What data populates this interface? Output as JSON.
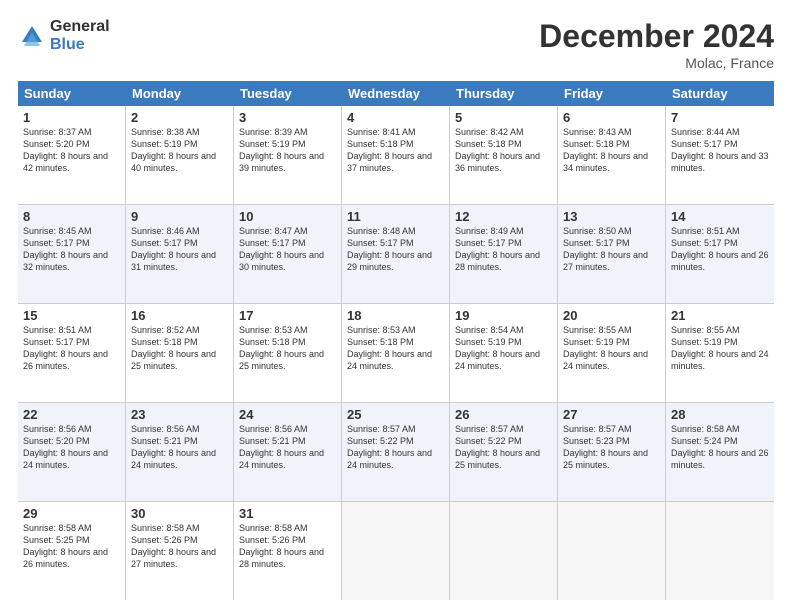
{
  "header": {
    "logo_general": "General",
    "logo_blue": "Blue",
    "month_title": "December 2024",
    "location": "Molac, France"
  },
  "weekdays": [
    "Sunday",
    "Monday",
    "Tuesday",
    "Wednesday",
    "Thursday",
    "Friday",
    "Saturday"
  ],
  "weeks": [
    [
      {
        "day": "1",
        "sunrise": "Sunrise: 8:37 AM",
        "sunset": "Sunset: 5:20 PM",
        "daylight": "Daylight: 8 hours and 42 minutes."
      },
      {
        "day": "2",
        "sunrise": "Sunrise: 8:38 AM",
        "sunset": "Sunset: 5:19 PM",
        "daylight": "Daylight: 8 hours and 40 minutes."
      },
      {
        "day": "3",
        "sunrise": "Sunrise: 8:39 AM",
        "sunset": "Sunset: 5:19 PM",
        "daylight": "Daylight: 8 hours and 39 minutes."
      },
      {
        "day": "4",
        "sunrise": "Sunrise: 8:41 AM",
        "sunset": "Sunset: 5:18 PM",
        "daylight": "Daylight: 8 hours and 37 minutes."
      },
      {
        "day": "5",
        "sunrise": "Sunrise: 8:42 AM",
        "sunset": "Sunset: 5:18 PM",
        "daylight": "Daylight: 8 hours and 36 minutes."
      },
      {
        "day": "6",
        "sunrise": "Sunrise: 8:43 AM",
        "sunset": "Sunset: 5:18 PM",
        "daylight": "Daylight: 8 hours and 34 minutes."
      },
      {
        "day": "7",
        "sunrise": "Sunrise: 8:44 AM",
        "sunset": "Sunset: 5:17 PM",
        "daylight": "Daylight: 8 hours and 33 minutes."
      }
    ],
    [
      {
        "day": "8",
        "sunrise": "Sunrise: 8:45 AM",
        "sunset": "Sunset: 5:17 PM",
        "daylight": "Daylight: 8 hours and 32 minutes."
      },
      {
        "day": "9",
        "sunrise": "Sunrise: 8:46 AM",
        "sunset": "Sunset: 5:17 PM",
        "daylight": "Daylight: 8 hours and 31 minutes."
      },
      {
        "day": "10",
        "sunrise": "Sunrise: 8:47 AM",
        "sunset": "Sunset: 5:17 PM",
        "daylight": "Daylight: 8 hours and 30 minutes."
      },
      {
        "day": "11",
        "sunrise": "Sunrise: 8:48 AM",
        "sunset": "Sunset: 5:17 PM",
        "daylight": "Daylight: 8 hours and 29 minutes."
      },
      {
        "day": "12",
        "sunrise": "Sunrise: 8:49 AM",
        "sunset": "Sunset: 5:17 PM",
        "daylight": "Daylight: 8 hours and 28 minutes."
      },
      {
        "day": "13",
        "sunrise": "Sunrise: 8:50 AM",
        "sunset": "Sunset: 5:17 PM",
        "daylight": "Daylight: 8 hours and 27 minutes."
      },
      {
        "day": "14",
        "sunrise": "Sunrise: 8:51 AM",
        "sunset": "Sunset: 5:17 PM",
        "daylight": "Daylight: 8 hours and 26 minutes."
      }
    ],
    [
      {
        "day": "15",
        "sunrise": "Sunrise: 8:51 AM",
        "sunset": "Sunset: 5:17 PM",
        "daylight": "Daylight: 8 hours and 26 minutes."
      },
      {
        "day": "16",
        "sunrise": "Sunrise: 8:52 AM",
        "sunset": "Sunset: 5:18 PM",
        "daylight": "Daylight: 8 hours and 25 minutes."
      },
      {
        "day": "17",
        "sunrise": "Sunrise: 8:53 AM",
        "sunset": "Sunset: 5:18 PM",
        "daylight": "Daylight: 8 hours and 25 minutes."
      },
      {
        "day": "18",
        "sunrise": "Sunrise: 8:53 AM",
        "sunset": "Sunset: 5:18 PM",
        "daylight": "Daylight: 8 hours and 24 minutes."
      },
      {
        "day": "19",
        "sunrise": "Sunrise: 8:54 AM",
        "sunset": "Sunset: 5:19 PM",
        "daylight": "Daylight: 8 hours and 24 minutes."
      },
      {
        "day": "20",
        "sunrise": "Sunrise: 8:55 AM",
        "sunset": "Sunset: 5:19 PM",
        "daylight": "Daylight: 8 hours and 24 minutes."
      },
      {
        "day": "21",
        "sunrise": "Sunrise: 8:55 AM",
        "sunset": "Sunset: 5:19 PM",
        "daylight": "Daylight: 8 hours and 24 minutes."
      }
    ],
    [
      {
        "day": "22",
        "sunrise": "Sunrise: 8:56 AM",
        "sunset": "Sunset: 5:20 PM",
        "daylight": "Daylight: 8 hours and 24 minutes."
      },
      {
        "day": "23",
        "sunrise": "Sunrise: 8:56 AM",
        "sunset": "Sunset: 5:21 PM",
        "daylight": "Daylight: 8 hours and 24 minutes."
      },
      {
        "day": "24",
        "sunrise": "Sunrise: 8:56 AM",
        "sunset": "Sunset: 5:21 PM",
        "daylight": "Daylight: 8 hours and 24 minutes."
      },
      {
        "day": "25",
        "sunrise": "Sunrise: 8:57 AM",
        "sunset": "Sunset: 5:22 PM",
        "daylight": "Daylight: 8 hours and 24 minutes."
      },
      {
        "day": "26",
        "sunrise": "Sunrise: 8:57 AM",
        "sunset": "Sunset: 5:22 PM",
        "daylight": "Daylight: 8 hours and 25 minutes."
      },
      {
        "day": "27",
        "sunrise": "Sunrise: 8:57 AM",
        "sunset": "Sunset: 5:23 PM",
        "daylight": "Daylight: 8 hours and 25 minutes."
      },
      {
        "day": "28",
        "sunrise": "Sunrise: 8:58 AM",
        "sunset": "Sunset: 5:24 PM",
        "daylight": "Daylight: 8 hours and 26 minutes."
      }
    ],
    [
      {
        "day": "29",
        "sunrise": "Sunrise: 8:58 AM",
        "sunset": "Sunset: 5:25 PM",
        "daylight": "Daylight: 8 hours and 26 minutes."
      },
      {
        "day": "30",
        "sunrise": "Sunrise: 8:58 AM",
        "sunset": "Sunset: 5:26 PM",
        "daylight": "Daylight: 8 hours and 27 minutes."
      },
      {
        "day": "31",
        "sunrise": "Sunrise: 8:58 AM",
        "sunset": "Sunset: 5:26 PM",
        "daylight": "Daylight: 8 hours and 28 minutes."
      },
      null,
      null,
      null,
      null
    ]
  ]
}
